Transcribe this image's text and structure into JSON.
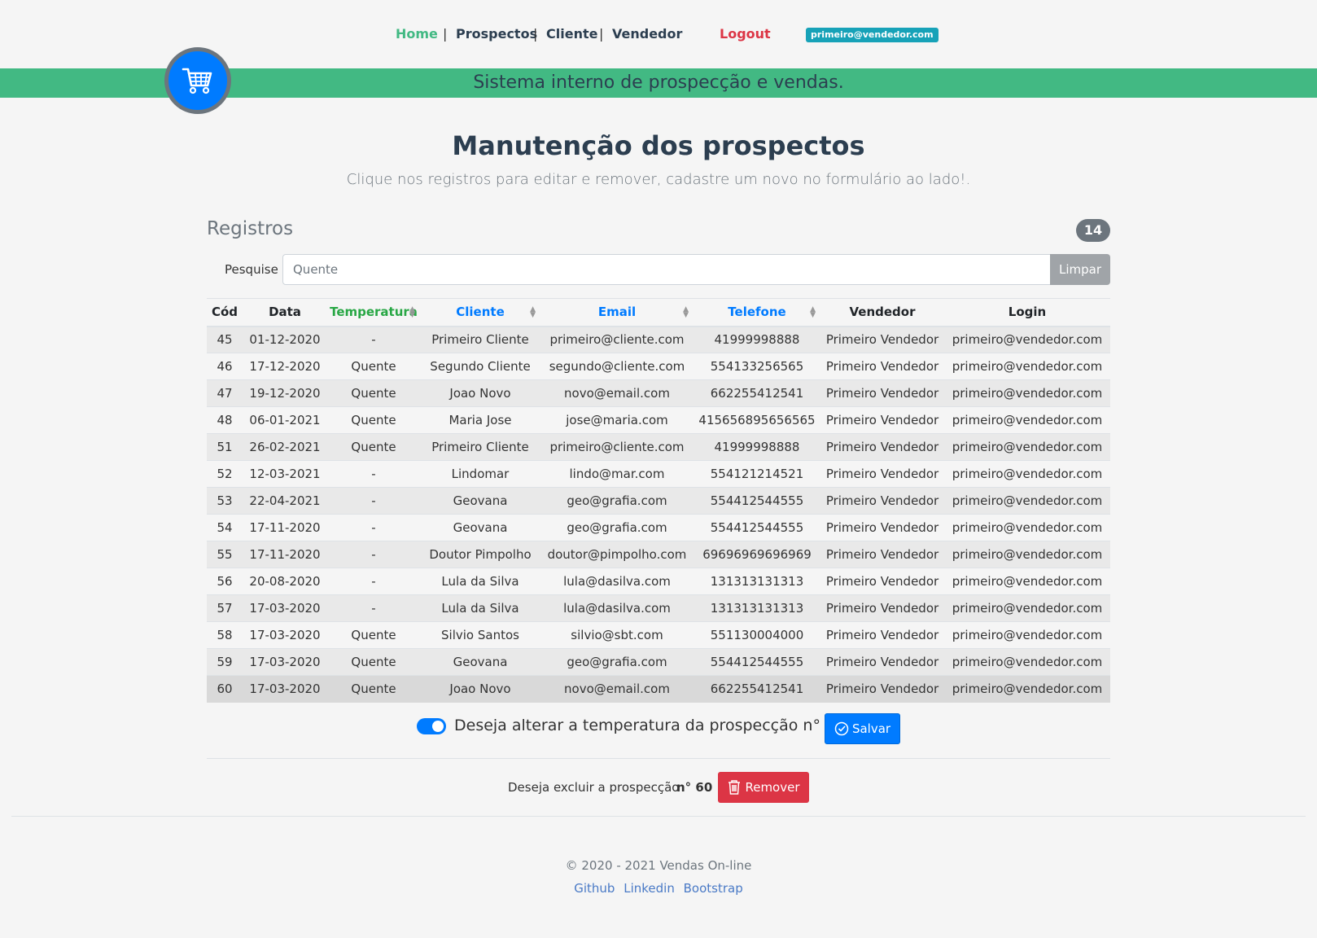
{
  "nav": {
    "home": "Home",
    "prospectos": "Prospectos",
    "cliente": "Cliente",
    "vendedor": "Vendedor",
    "logout": "Logout",
    "separator": "|",
    "user_email": "primeiro@vendedor.com"
  },
  "banner": {
    "text": "Sistema interno de prospecção e vendas.",
    "logo_icon": "shopping-cart-icon"
  },
  "page": {
    "title": "Manutenção dos prospectos",
    "subtitle": "Clique nos registros para editar e remover, cadastre um novo no formulário ao lado!."
  },
  "registros": {
    "title": "Registros",
    "count": "14"
  },
  "search": {
    "label": "Pesquise",
    "value": "",
    "placeholder": "Quente",
    "clear_label": "Limpar"
  },
  "table": {
    "headers": [
      "Cód",
      "Data",
      "Temperatura",
      "Cliente",
      "Email",
      "Telefone",
      "Vendedor",
      "Login"
    ],
    "rows": [
      [
        "45",
        "01-12-2020",
        "-",
        "Primeiro Cliente",
        "primeiro@cliente.com",
        "41999998888",
        "Primeiro Vendedor",
        "primeiro@vendedor.com"
      ],
      [
        "46",
        "17-12-2020",
        "Quente",
        "Segundo Cliente",
        "segundo@cliente.com",
        "554133256565",
        "Primeiro Vendedor",
        "primeiro@vendedor.com"
      ],
      [
        "47",
        "19-12-2020",
        "Quente",
        "Joao Novo",
        "novo@email.com",
        "662255412541",
        "Primeiro Vendedor",
        "primeiro@vendedor.com"
      ],
      [
        "48",
        "06-01-2021",
        "Quente",
        "Maria Jose",
        "jose@maria.com",
        "415656895656565",
        "Primeiro Vendedor",
        "primeiro@vendedor.com"
      ],
      [
        "51",
        "26-02-2021",
        "Quente",
        "Primeiro Cliente",
        "primeiro@cliente.com",
        "41999998888",
        "Primeiro Vendedor",
        "primeiro@vendedor.com"
      ],
      [
        "52",
        "12-03-2021",
        "-",
        "Lindomar",
        "lindo@mar.com",
        "554121214521",
        "Primeiro Vendedor",
        "primeiro@vendedor.com"
      ],
      [
        "53",
        "22-04-2021",
        "-",
        "Geovana",
        "geo@grafia.com",
        "554412544555",
        "Primeiro Vendedor",
        "primeiro@vendedor.com"
      ],
      [
        "54",
        "17-11-2020",
        "-",
        "Geovana",
        "geo@grafia.com",
        "554412544555",
        "Primeiro Vendedor",
        "primeiro@vendedor.com"
      ],
      [
        "55",
        "17-11-2020",
        "-",
        "Doutor Pimpolho",
        "doutor@pimpolho.com",
        "69696969696969",
        "Primeiro Vendedor",
        "primeiro@vendedor.com"
      ],
      [
        "56",
        "20-08-2020",
        "-",
        "Lula da Silva",
        "lula@dasilva.com",
        "131313131313",
        "Primeiro Vendedor",
        "primeiro@vendedor.com"
      ],
      [
        "57",
        "17-03-2020",
        "-",
        "Lula da Silva",
        "lula@dasilva.com",
        "131313131313",
        "Primeiro Vendedor",
        "primeiro@vendedor.com"
      ],
      [
        "58",
        "17-03-2020",
        "Quente",
        "Silvio Santos",
        "silvio@sbt.com",
        "551130004000",
        "Primeiro Vendedor",
        "primeiro@vendedor.com"
      ],
      [
        "59",
        "17-03-2020",
        "Quente",
        "Geovana",
        "geo@grafia.com",
        "554412544555",
        "Primeiro Vendedor",
        "primeiro@vendedor.com"
      ],
      [
        "60",
        "17-03-2020",
        "Quente",
        "Joao Novo",
        "novo@email.com",
        "662255412541",
        "Primeiro Vendedor",
        "primeiro@vendedor.com"
      ]
    ],
    "selected_index": 13
  },
  "temperature_toggle": {
    "checked": true,
    "text": "Deseja alterar a temperatura da prospecção n° 60 ?",
    "save_label": "Salvar"
  },
  "delete": {
    "text": "Deseja excluir a prospecção",
    "number": "n° 60",
    "remove_label": "Remover"
  },
  "footer": {
    "copyright": "© 2020 - 2021 Vendas On-line",
    "links": [
      "Github",
      "Linkedin",
      "Bootstrap"
    ]
  },
  "colors": {
    "accent_green": "#42b983",
    "primary": "#007bff",
    "danger": "#dc3545",
    "info": "#17a2b8",
    "secondary": "#6c757d"
  }
}
